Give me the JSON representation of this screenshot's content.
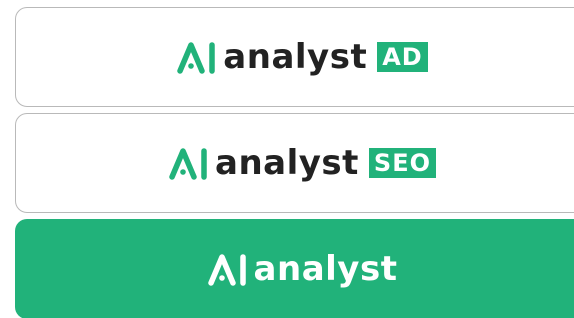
{
  "cards": [
    {
      "id": "ad",
      "wordmark": "analyst",
      "badge": "AD",
      "style": "outline"
    },
    {
      "id": "seo",
      "wordmark": "analyst",
      "badge": "SEO",
      "style": "outline"
    },
    {
      "id": "main",
      "wordmark": "analyst",
      "badge": "",
      "style": "filled"
    }
  ],
  "colors": {
    "brand_green": "#21b27a",
    "wordmark_dark": "#222222",
    "card_border": "#b9b9b9",
    "background": "#ffffff"
  },
  "icons": {
    "ai_mark": "ai-logo-icon"
  }
}
